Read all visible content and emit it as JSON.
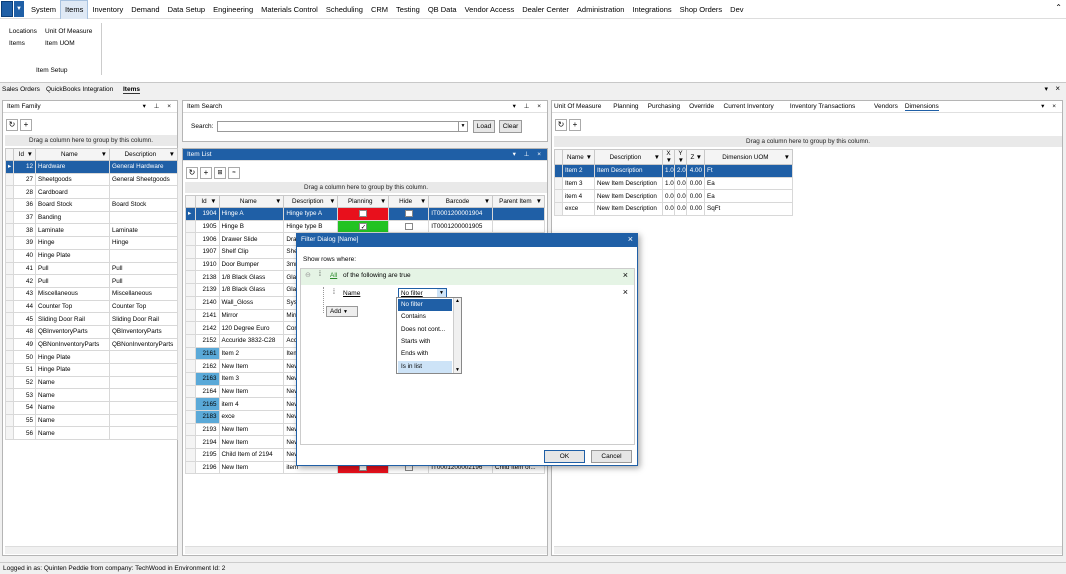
{
  "menu": {
    "items": [
      "System",
      "Items",
      "Inventory",
      "Demand",
      "Data Setup",
      "Engineering",
      "Materials Control",
      "Scheduling",
      "CRM",
      "Testing",
      "QB Data",
      "Vendor Access",
      "Dealer Center",
      "Administration",
      "Integrations",
      "Shop Orders",
      "Dev"
    ],
    "active_index": 1
  },
  "ribbon": {
    "col1": [
      "Locations",
      "Items"
    ],
    "col2": [
      "Unit Of Measure",
      "Item UOM"
    ],
    "group_label": "Item Setup"
  },
  "doc_tabs": [
    "Sales Orders",
    "QuickBooks Integration",
    "Items"
  ],
  "item_family": {
    "title": "Item Family",
    "group_hint": "Drag a column here to group by this column.",
    "columns": [
      "Id",
      "Name",
      "Description"
    ],
    "rows": [
      [
        "12",
        "Hardware",
        "General Hardware"
      ],
      [
        "27",
        "Sheetgoods",
        "General Sheetgoods"
      ],
      [
        "28",
        "Cardboard",
        ""
      ],
      [
        "36",
        "Board Stock",
        "Board Stock"
      ],
      [
        "37",
        "Banding",
        ""
      ],
      [
        "38",
        "Laminate",
        "Laminate"
      ],
      [
        "39",
        "Hinge",
        "Hinge"
      ],
      [
        "40",
        "Hinge Plate",
        ""
      ],
      [
        "41",
        "Pull",
        "Pull"
      ],
      [
        "42",
        "Pull",
        "Pull"
      ],
      [
        "43",
        "Miscellaneous",
        "Miscellaneous"
      ],
      [
        "44",
        "Counter Top",
        "Counter Top"
      ],
      [
        "45",
        "Sliding Door Rail",
        "Sliding Door Rail"
      ],
      [
        "48",
        "QBInventoryParts",
        "QBInventoryParts"
      ],
      [
        "49",
        "QBNonInventoryParts",
        "QBNonInventoryParts"
      ],
      [
        "50",
        "Hinge Plate",
        ""
      ],
      [
        "51",
        "Hinge Plate",
        ""
      ],
      [
        "52",
        "Name",
        ""
      ],
      [
        "53",
        "Name",
        ""
      ],
      [
        "54",
        "Name",
        ""
      ],
      [
        "55",
        "Name",
        ""
      ],
      [
        "56",
        "Name",
        ""
      ]
    ]
  },
  "item_search": {
    "title": "Item Search",
    "search_label": "Search:",
    "search_value": "",
    "load": "Load",
    "clear": "Clear"
  },
  "item_list": {
    "title": "Item List",
    "group_hint": "Drag a column here to group by this column.",
    "columns": [
      "Id",
      "Name",
      "Description",
      "Planning",
      "Hide",
      "Barcode",
      "Parent Item"
    ],
    "rows": [
      {
        "id": "1904",
        "name": "Hinge A",
        "desc": "Hinge type A",
        "barcode": "IT0001200001904",
        "parent": ""
      },
      {
        "id": "1905",
        "name": "Hinge B",
        "desc": "Hinge type B",
        "barcode": "IT0001200001905",
        "parent": ""
      },
      {
        "id": "1906",
        "name": "Drawer Slide",
        "desc": "Draw",
        "barcode": "",
        "parent": ""
      },
      {
        "id": "1907",
        "name": "Shelf Clip",
        "desc": "Shelf",
        "barcode": "",
        "parent": ""
      },
      {
        "id": "1910",
        "name": "Door Bumper",
        "desc": "3mm",
        "barcode": "",
        "parent": ""
      },
      {
        "id": "2138",
        "name": "1/8 Black Glass",
        "desc": "Glass",
        "barcode": "",
        "parent": ""
      },
      {
        "id": "2139",
        "name": "1/8 Black Glass",
        "desc": "Glass",
        "barcode": "",
        "parent": ""
      },
      {
        "id": "2140",
        "name": "Wall_Gloss",
        "desc": "Syste",
        "barcode": "",
        "parent": ""
      },
      {
        "id": "2141",
        "name": "Mirror",
        "desc": "Mirro",
        "barcode": "",
        "parent": ""
      },
      {
        "id": "2142",
        "name": "120 Degree Euro",
        "desc": "Conc",
        "barcode": "",
        "parent": ""
      },
      {
        "id": "2152",
        "name": "Accuride 3832-C28",
        "desc": "Accu",
        "barcode": "",
        "parent": ""
      },
      {
        "id": "2161",
        "name": "Item 2",
        "desc": "Item I",
        "barcode": "",
        "parent": ""
      },
      {
        "id": "2162",
        "name": "New Item",
        "desc": "New",
        "barcode": "",
        "parent": ""
      },
      {
        "id": "2163",
        "name": "Item 3",
        "desc": "New",
        "barcode": "",
        "parent": ""
      },
      {
        "id": "2164",
        "name": "New Item",
        "desc": "New",
        "barcode": "",
        "parent": ""
      },
      {
        "id": "2165",
        "name": "item 4",
        "desc": "New",
        "barcode": "",
        "parent": ""
      },
      {
        "id": "2183",
        "name": "exce",
        "desc": "New",
        "barcode": "",
        "parent": ""
      },
      {
        "id": "2193",
        "name": "New Item",
        "desc": "New",
        "barcode": "",
        "parent": ""
      },
      {
        "id": "2194",
        "name": "New Item",
        "desc": "New",
        "barcode": "",
        "parent": ""
      },
      {
        "id": "2195",
        "name": "Child Item of 2194",
        "desc": "New",
        "barcode": "",
        "parent": ""
      },
      {
        "id": "2196",
        "name": "New Item",
        "desc": "item",
        "barcode": "IT0001200002196",
        "parent": "Child Item of..."
      }
    ]
  },
  "right_panel": {
    "tabs": [
      "Unit Of Measure",
      "Planning",
      "Purchasing",
      "Override",
      "Current Inventory",
      "Inventory Transactions",
      "Vendors",
      "Dimensions"
    ],
    "active_tab": 7,
    "group_hint": "Drag a column here to group by this column.",
    "columns": [
      "Name",
      "Description",
      "X",
      "Y",
      "Z",
      "Dimension UOM"
    ],
    "rows": [
      [
        "Item 2",
        "Item Description",
        "1.00",
        "2.00",
        "4.00",
        "Ft"
      ],
      [
        "Item 3",
        "New Item Description",
        "1.00",
        "0.00",
        "0.00",
        "Ea"
      ],
      [
        "item 4",
        "New Item Description",
        "0.00",
        "0.00",
        "0.00",
        "Ea"
      ],
      [
        "exce",
        "New Item Description",
        "0.00",
        "0.00",
        "0.00",
        "SqFt"
      ]
    ]
  },
  "filter_dialog": {
    "title": "Filter Dialog [Name]",
    "show_rows": "Show rows where:",
    "all": "All",
    "following": "of the following are true",
    "field": "Name",
    "operator": "No filter",
    "add": "Add",
    "ok": "OK",
    "cancel": "Cancel",
    "options": [
      "No filter",
      "Contains",
      "Does not cont...",
      "Starts with",
      "Ends with",
      "Is in list"
    ]
  },
  "status": "Logged in as: Quinten Peddie  from company: TechWood in  Environment Id: 2",
  "colors": {
    "accent": "#1f5fa6",
    "red": "#e8101c",
    "green": "#22c322",
    "highlight": "#5aa9d8"
  }
}
